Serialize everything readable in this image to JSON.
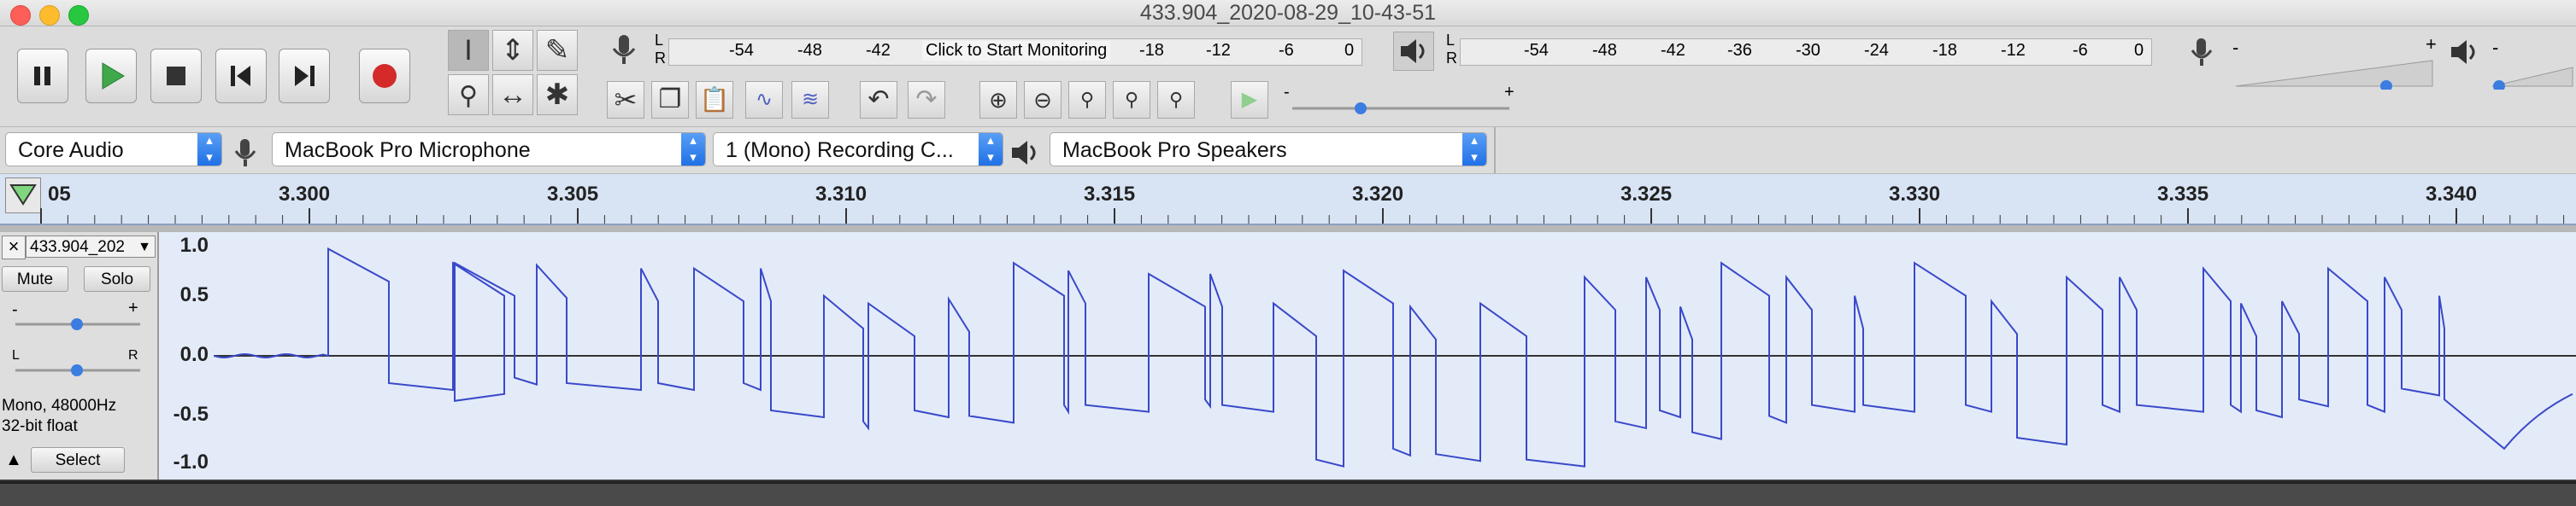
{
  "window": {
    "title": "433.904_2020-08-29_10-43-51"
  },
  "meters": {
    "record_label": "Click to Start Monitoring",
    "record_ticks": [
      "-54",
      "-48",
      "-42",
      "-18",
      "-12",
      "-6",
      "0"
    ],
    "play_ticks": [
      "-54",
      "-48",
      "-42",
      "-36",
      "-30",
      "-24",
      "-18",
      "-12",
      "-6",
      "0"
    ],
    "lr": [
      "L",
      "R"
    ]
  },
  "sliders": {
    "minus": "-",
    "plus": "+"
  },
  "devices": {
    "host": "Core Audio",
    "input": "MacBook Pro Microphone",
    "channels": "1 (Mono) Recording C...",
    "output": "MacBook Pro Speakers"
  },
  "ruler": {
    "first_label": "05",
    "labels": [
      "3.300",
      "3.305",
      "3.310",
      "3.315",
      "3.320",
      "3.325",
      "3.330",
      "3.335",
      "3.340"
    ]
  },
  "track": {
    "name": "433.904_202",
    "mute": "Mute",
    "solo": "Solo",
    "info_line1": "Mono, 48000Hz",
    "info_line2": "32-bit float",
    "select": "Select",
    "gain_minus": "-",
    "gain_plus": "+",
    "pan_left": "L",
    "pan_right": "R"
  },
  "yaxis": [
    "1.0",
    "0.5",
    "0.0",
    "-0.5",
    "-1.0"
  ],
  "colors": {
    "waveform": "#3a49c9",
    "record": "#d42a2a",
    "play": "#3fa84a",
    "wave_bg": "#e3ebf9"
  },
  "icons": {
    "transport": [
      "pause-icon",
      "play-icon",
      "stop-icon",
      "skip-start-icon",
      "skip-end-icon",
      "record-icon"
    ],
    "tools": [
      "selection-tool-icon",
      "envelope-tool-icon",
      "draw-tool-icon",
      "zoom-tool-icon",
      "timeshift-tool-icon",
      "multi-tool-icon"
    ]
  }
}
